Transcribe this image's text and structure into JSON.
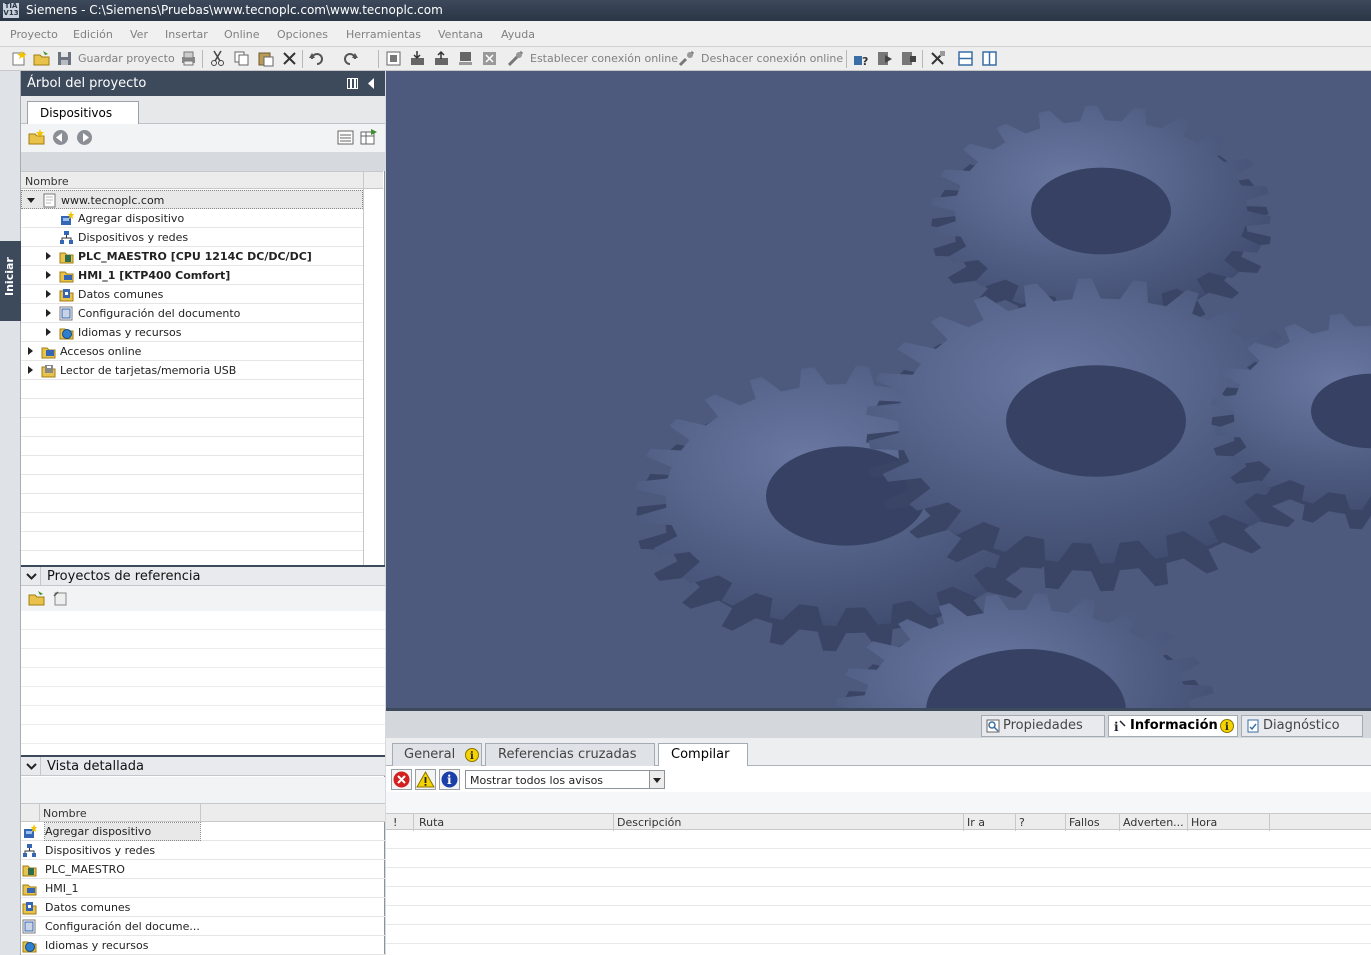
{
  "window": {
    "title": "Siemens  -  C:\\Siemens\\Pruebas\\www.tecnoplc.com\\www.tecnoplc.com",
    "logo_top": "TIA",
    "logo_bottom": "V13"
  },
  "menu": [
    "Proyecto",
    "Edición",
    "Ver",
    "Insertar",
    "Online",
    "Opciones",
    "Herramientas",
    "Ventana",
    "Ayuda"
  ],
  "toolbar": {
    "save_label": "Guardar proyecto",
    "go_online_label": "Establecer conexión online",
    "go_offline_label": "Deshacer conexión online"
  },
  "side_tab": {
    "label": "Iniciar"
  },
  "project_tree": {
    "title": "Árbol del proyecto",
    "tab": "Dispositivos",
    "column_name": "Nombre",
    "items": [
      {
        "label": "www.tecnoplc.com",
        "level": 0,
        "expander": "down",
        "icon": "project-icon",
        "bold": false,
        "selected": true
      },
      {
        "label": "Agregar dispositivo",
        "level": 1,
        "expander": "none",
        "icon": "add-device-icon",
        "bold": false
      },
      {
        "label": "Dispositivos y redes",
        "level": 1,
        "expander": "none",
        "icon": "network-icon",
        "bold": false
      },
      {
        "label": "PLC_MAESTRO [CPU 1214C DC/DC/DC]",
        "level": 1,
        "expander": "right",
        "icon": "plc-icon",
        "bold": true
      },
      {
        "label": "HMI_1 [KTP400 Comfort]",
        "level": 1,
        "expander": "right",
        "icon": "hmi-icon",
        "bold": true
      },
      {
        "label": "Datos comunes",
        "level": 1,
        "expander": "right",
        "icon": "common-data-icon",
        "bold": false
      },
      {
        "label": "Configuración del documento",
        "level": 1,
        "expander": "right",
        "icon": "document-settings-icon",
        "bold": false
      },
      {
        "label": "Idiomas y recursos",
        "level": 1,
        "expander": "right",
        "icon": "languages-icon",
        "bold": false
      },
      {
        "label": "Accesos online",
        "level": 0,
        "expander": "right",
        "icon": "online-access-icon",
        "bold": false
      },
      {
        "label": "Lector de tarjetas/memoria USB",
        "level": 0,
        "expander": "right",
        "icon": "card-reader-icon",
        "bold": false
      }
    ]
  },
  "reference_projects": {
    "title": "Proyectos de referencia"
  },
  "detail_view": {
    "title": "Vista detallada",
    "column_name": "Nombre",
    "items": [
      {
        "label": "Agregar dispositivo",
        "icon": "add-device-icon",
        "selected": true
      },
      {
        "label": "Dispositivos y redes",
        "icon": "network-icon"
      },
      {
        "label": "PLC_MAESTRO",
        "icon": "plc-icon"
      },
      {
        "label": "HMI_1",
        "icon": "hmi-icon"
      },
      {
        "label": "Datos comunes",
        "icon": "common-data-icon"
      },
      {
        "label": "Configuración del docume...",
        "icon": "document-settings-icon"
      },
      {
        "label": "Idiomas y recursos",
        "icon": "languages-icon"
      }
    ]
  },
  "inspector": {
    "tabs": [
      "Propiedades",
      "Información",
      "Diagnóstico"
    ],
    "active_tab": "Información",
    "subtabs": [
      "General",
      "Referencias cruzadas",
      "Compilar"
    ],
    "active_subtab": "Compilar",
    "filter": "Mostrar todos los avisos",
    "columns": [
      "!",
      "Ruta",
      "Descripción",
      "Ir a",
      "?",
      "Fallos",
      "Adverten...",
      "Hora"
    ]
  },
  "colors": {
    "header_dark": "#3d4a5c",
    "workspace_bg": "#4d5a7e",
    "gear_color": "#5a6890"
  }
}
